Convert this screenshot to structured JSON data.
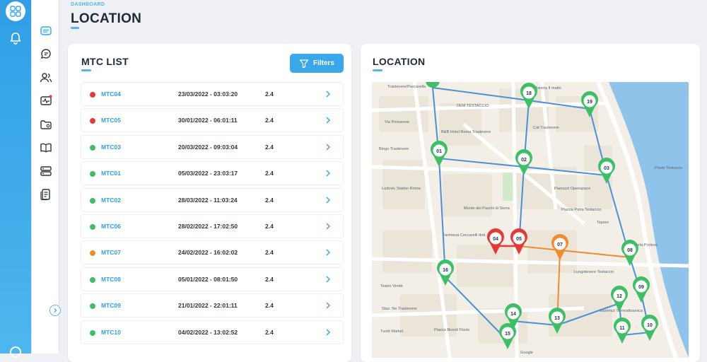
{
  "breadcrumb": "DASHBOARD",
  "page_title": "LOCATION",
  "list": {
    "title": "MTC LIST",
    "filters_label": "Filters",
    "rows": [
      {
        "id": "MTC04",
        "datetime": "23/03/2022 - 03:03:20",
        "value": "2.4",
        "status": "red"
      },
      {
        "id": "MTC05",
        "datetime": "30/01/2022 - 06:01:11",
        "value": "2.4",
        "status": "red"
      },
      {
        "id": "MTC03",
        "datetime": "20/03/2022 - 09:03:04",
        "value": "2.4",
        "status": "green"
      },
      {
        "id": "MTC01",
        "datetime": "05/03/2022 - 23:03:17",
        "value": "2.4",
        "status": "green"
      },
      {
        "id": "MTC02",
        "datetime": "28/03/2022 - 11:03:24",
        "value": "2.4",
        "status": "green"
      },
      {
        "id": "MTC06",
        "datetime": "28/02/2022 - 17:02:50",
        "value": "2.4",
        "status": "green"
      },
      {
        "id": "MTC07",
        "datetime": "24/02/2022 - 16:02:02",
        "value": "2.4",
        "status": "orange"
      },
      {
        "id": "MTC08",
        "datetime": "05/01/2022 - 08:01:50",
        "value": "2.4",
        "status": "green"
      },
      {
        "id": "MTC09",
        "datetime": "21/01/2022 - 22:01:11",
        "value": "2.4",
        "status": "green"
      },
      {
        "id": "MTC10",
        "datetime": "04/02/2022 - 13:02:52",
        "value": "2.4",
        "status": "green"
      }
    ]
  },
  "map": {
    "title": "LOCATION",
    "markers": [
      {
        "label": "01",
        "status": "green"
      },
      {
        "label": "02",
        "status": "green"
      },
      {
        "label": "03",
        "status": "green"
      },
      {
        "label": "04",
        "status": "red"
      },
      {
        "label": "05",
        "status": "red"
      },
      {
        "label": "07",
        "status": "orange"
      },
      {
        "label": "08",
        "status": "green"
      },
      {
        "label": "09",
        "status": "green"
      },
      {
        "label": "10",
        "status": "green"
      },
      {
        "label": "11",
        "status": "green"
      },
      {
        "label": "12",
        "status": "green"
      },
      {
        "label": "13",
        "status": "green"
      },
      {
        "label": "14",
        "status": "green"
      },
      {
        "label": "15",
        "status": "green"
      },
      {
        "label": "16",
        "status": "green"
      },
      {
        "label": "18",
        "status": "green"
      },
      {
        "label": "19",
        "status": "green"
      }
    ],
    "place_labels": [
      "Trastevere/Pascarella",
      "DEM TESTACCIO",
      "B&B Hotel Roma Trastevere",
      "Caf Trastevere",
      "Bingo Trastevere",
      "Via Portuense",
      "Ludovic Station Roma",
      "Monte dei Paschi di Siena",
      "Farmacia Ceccarelli dott. Matteo",
      "Piazza Porta Testaccio",
      "Lungotevere Testaccio",
      "Teatro Verde",
      "Tuodi Market",
      "Piazza Biondi Flavio",
      "Staz. Ne Trastevere",
      "Porta Portese",
      "Ponte Testaccio",
      "Mammut Termodinamica",
      "Google",
      "Osteria Il matto",
      "Tepore",
      "Pianuzzi Openspace"
    ]
  },
  "colors": {
    "accent": "#3aa7e8",
    "green": "#3dbf66",
    "red": "#e53935",
    "orange": "#f28a2e",
    "route_blue": "#4a90d9"
  }
}
